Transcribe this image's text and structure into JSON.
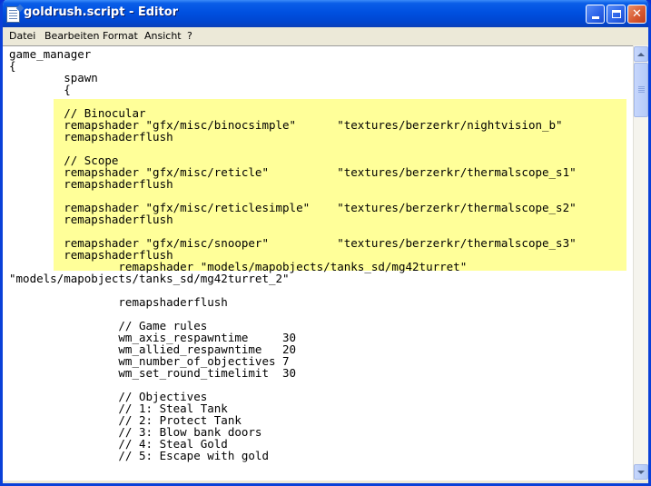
{
  "window": {
    "title": "goldrush.script - Editor"
  },
  "menu": {
    "items": [
      "Datei",
      "Bearbeiten",
      "Format",
      "Ansicht",
      "?"
    ]
  },
  "titlebar_buttons": {
    "minimize_icon": "minimize-icon",
    "maximize_icon": "maximize-icon",
    "close_icon": "close-icon",
    "close_glyph": "✕"
  },
  "editor": {
    "highlight_color": "#ffff99",
    "lines": [
      "game_manager",
      "{",
      "\tspawn",
      "\t{",
      "",
      "\t// Binocular",
      "\tremapshader \"gfx/misc/binocsimple\"      \"textures/berzerkr/nightvision_b\"",
      "\tremapshaderflush",
      "",
      "\t// Scope",
      "\tremapshader \"gfx/misc/reticle\"          \"textures/berzerkr/thermalscope_s1\"",
      "\tremapshaderflush",
      "",
      "\tremapshader \"gfx/misc/reticlesimple\"    \"textures/berzerkr/thermalscope_s2\"",
      "\tremapshaderflush",
      "",
      "\tremapshader \"gfx/misc/snooper\"          \"textures/berzerkr/thermalscope_s3\"",
      "\tremapshaderflush",
      "\t\tremapshader \"models/mapobjects/tanks_sd/mg42turret\"",
      "\"models/mapobjects/tanks_sd/mg42turret_2\"",
      "",
      "\t\tremapshaderflush",
      "",
      "\t\t// Game rules",
      "\t\twm_axis_respawntime     30",
      "\t\twm_allied_respawntime   20",
      "\t\twm_number_of_objectives 7",
      "\t\twm_set_round_timelimit  30",
      "",
      "\t\t// Objectives",
      "\t\t// 1: Steal Tank",
      "\t\t// 2: Protect Tank",
      "\t\t// 3: Blow bank doors",
      "\t\t// 4: Steal Gold",
      "\t\t// 5: Escape with gold"
    ]
  }
}
